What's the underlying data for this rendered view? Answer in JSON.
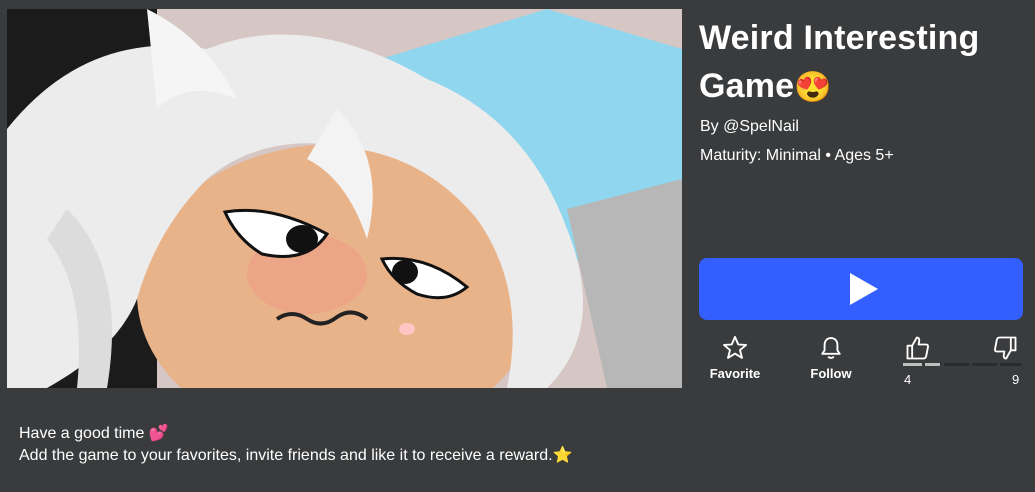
{
  "game": {
    "title": "Weird Interesting Game",
    "title_emoji": "😍",
    "creator": "By @SpelNail",
    "maturity": "Maturity: Minimal • Ages 5+"
  },
  "actions": {
    "favorite_label": "Favorite",
    "follow_label": "Follow"
  },
  "votes": {
    "up_count": "4",
    "down_count": "9",
    "up_fraction": 0.31
  },
  "description": {
    "line1": "Have a good time 💕",
    "line2": "Add the game to your favorites, invite friends and like it to receive a reward.⭐"
  },
  "colors": {
    "background": "#393b3d",
    "play_button": "#335fff",
    "text": "#ffffff"
  }
}
